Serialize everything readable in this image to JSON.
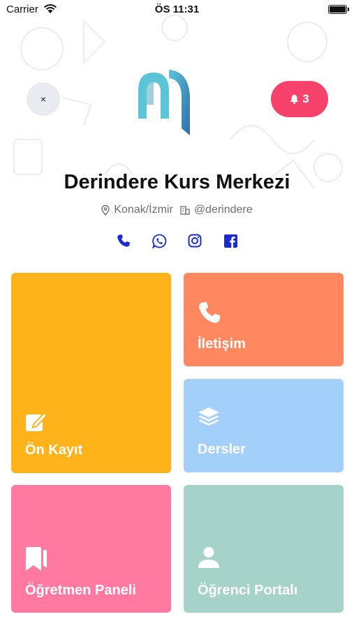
{
  "status_bar": {
    "carrier": "Carrier",
    "time": "ÖS 11:31"
  },
  "header": {
    "close_label": "×",
    "notification_count": "3",
    "logo_colors": [
      "#5bc4d6",
      "#2e6fa8"
    ]
  },
  "profile": {
    "title": "Derindere Kurs Merkezi",
    "location": "Konak/İzmir",
    "handle": "@derindere"
  },
  "social": {
    "color": "#1a2bd6",
    "icons": [
      "phone-icon",
      "whatsapp-icon",
      "instagram-icon",
      "facebook-icon"
    ]
  },
  "tiles": {
    "kayit": {
      "label": "Ön Kayıt",
      "color": "#ffb31a",
      "icon": "edit-icon"
    },
    "iletisim": {
      "label": "İletişim",
      "color": "#ff8861",
      "icon": "phone-icon"
    },
    "dersler": {
      "label": "Dersler",
      "color": "#a3d0fb",
      "icon": "layers-icon"
    },
    "ogretmen": {
      "label": "Öğretmen Paneli",
      "color": "#ff79a0",
      "icon": "bookmark-icon"
    },
    "ogrenci": {
      "label": "Öğrenci Portalı",
      "color": "#a5d3c9",
      "icon": "user-icon"
    }
  },
  "accent": {
    "notify": "#f7436c"
  }
}
